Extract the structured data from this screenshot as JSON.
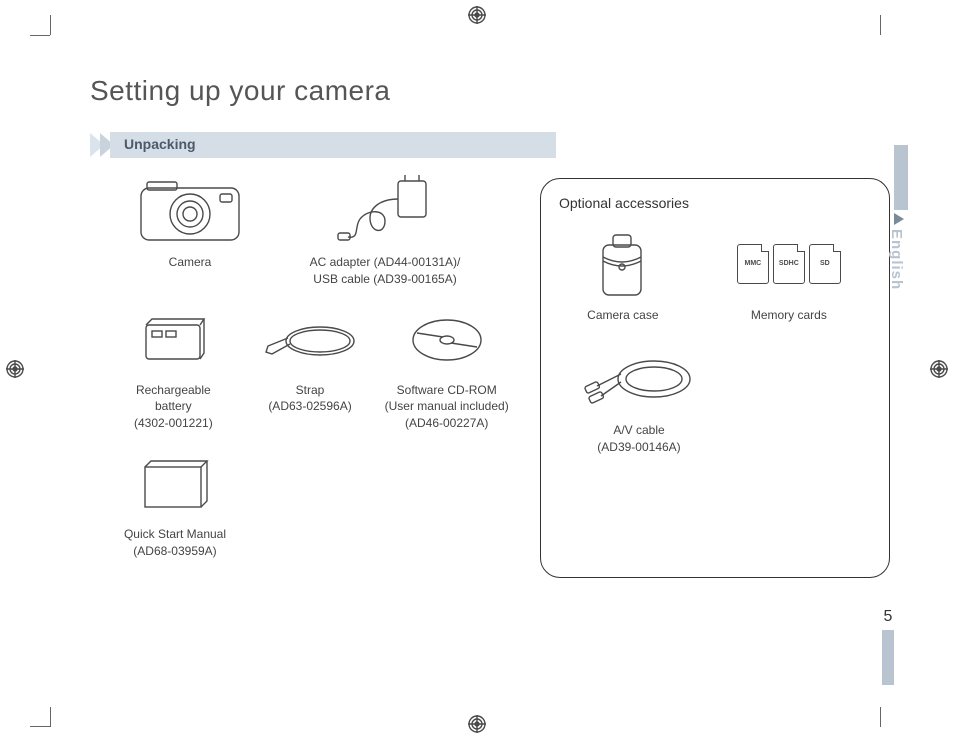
{
  "title": "Setting up your camera",
  "section_heading": "Unpacking",
  "side_language": "English",
  "page_number": "5",
  "included_items": {
    "camera": {
      "label": "Camera"
    },
    "ac_adapter": {
      "line1": "AC adapter (AD44-00131A)/",
      "line2": "USB cable (AD39-00165A)"
    },
    "battery": {
      "line1": "Rechargeable",
      "line2": "battery",
      "line3": "(4302-001221)"
    },
    "strap": {
      "line1": "Strap",
      "line2": "(AD63-02596A)"
    },
    "cdrom": {
      "line1": "Software CD-ROM",
      "line2": "(User manual included)",
      "line3": "(AD46-00227A)"
    },
    "qsm": {
      "line1": "Quick Start Manual",
      "line2": "(AD68-03959A)"
    }
  },
  "optional": {
    "heading": "Optional accessories",
    "case": {
      "label": "Camera case"
    },
    "memory": {
      "label": "Memory cards",
      "types": [
        "MMC",
        "SDHC",
        "SD"
      ]
    },
    "av": {
      "line1": "A/V cable",
      "line2": "(AD39-00146A)"
    }
  }
}
